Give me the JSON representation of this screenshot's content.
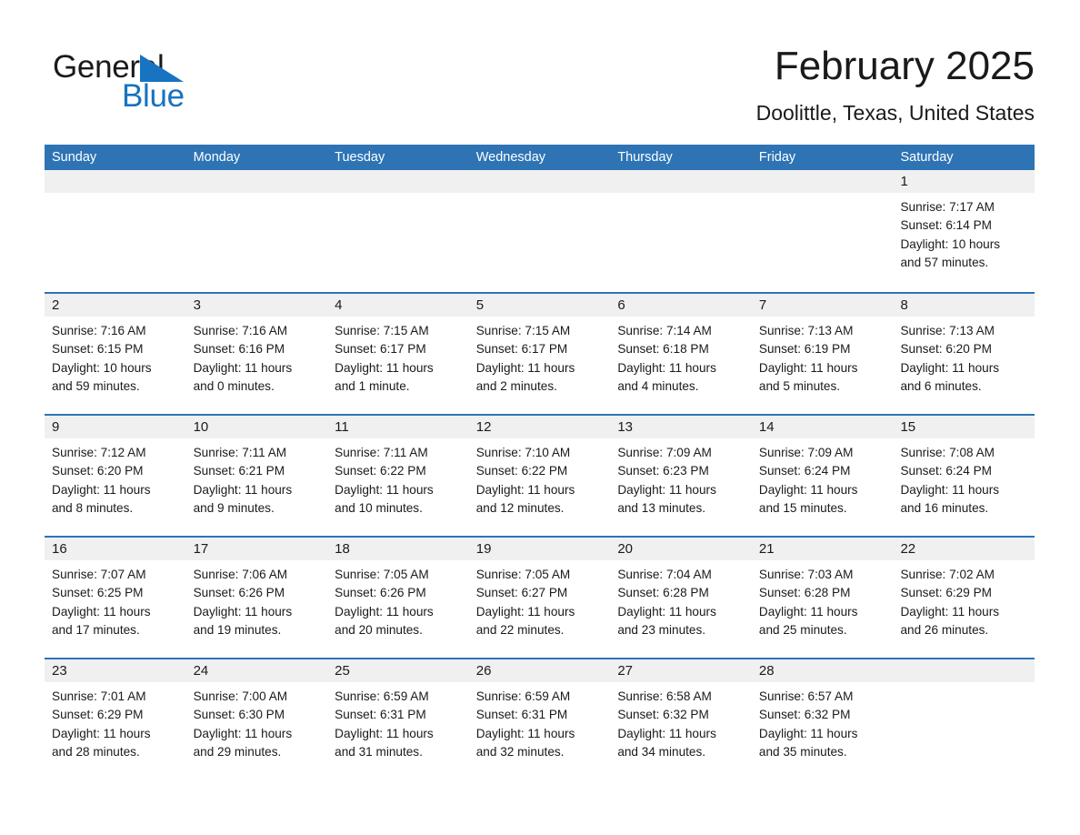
{
  "brand": {
    "name_part1": "General",
    "name_part2": "Blue",
    "triangle_color": "#1873c0",
    "text_color": "#1a1a1a"
  },
  "header": {
    "month_title": "February 2025",
    "location": "Doolittle, Texas, United States"
  },
  "colors": {
    "header_blue": "#2e74b5",
    "daynum_band": "#f0f0f0",
    "page_background": "#ffffff",
    "text": "#1a1a1a"
  },
  "weekday_headers": [
    "Sunday",
    "Monday",
    "Tuesday",
    "Wednesday",
    "Thursday",
    "Friday",
    "Saturday"
  ],
  "weeks": [
    [
      {
        "day": "",
        "lines": []
      },
      {
        "day": "",
        "lines": []
      },
      {
        "day": "",
        "lines": []
      },
      {
        "day": "",
        "lines": []
      },
      {
        "day": "",
        "lines": []
      },
      {
        "day": "",
        "lines": []
      },
      {
        "day": "1",
        "lines": [
          "Sunrise: 7:17 AM",
          "Sunset: 6:14 PM",
          "Daylight: 10 hours",
          "and 57 minutes."
        ]
      }
    ],
    [
      {
        "day": "2",
        "lines": [
          "Sunrise: 7:16 AM",
          "Sunset: 6:15 PM",
          "Daylight: 10 hours",
          "and 59 minutes."
        ]
      },
      {
        "day": "3",
        "lines": [
          "Sunrise: 7:16 AM",
          "Sunset: 6:16 PM",
          "Daylight: 11 hours",
          "and 0 minutes."
        ]
      },
      {
        "day": "4",
        "lines": [
          "Sunrise: 7:15 AM",
          "Sunset: 6:17 PM",
          "Daylight: 11 hours",
          "and 1 minute."
        ]
      },
      {
        "day": "5",
        "lines": [
          "Sunrise: 7:15 AM",
          "Sunset: 6:17 PM",
          "Daylight: 11 hours",
          "and 2 minutes."
        ]
      },
      {
        "day": "6",
        "lines": [
          "Sunrise: 7:14 AM",
          "Sunset: 6:18 PM",
          "Daylight: 11 hours",
          "and 4 minutes."
        ]
      },
      {
        "day": "7",
        "lines": [
          "Sunrise: 7:13 AM",
          "Sunset: 6:19 PM",
          "Daylight: 11 hours",
          "and 5 minutes."
        ]
      },
      {
        "day": "8",
        "lines": [
          "Sunrise: 7:13 AM",
          "Sunset: 6:20 PM",
          "Daylight: 11 hours",
          "and 6 minutes."
        ]
      }
    ],
    [
      {
        "day": "9",
        "lines": [
          "Sunrise: 7:12 AM",
          "Sunset: 6:20 PM",
          "Daylight: 11 hours",
          "and 8 minutes."
        ]
      },
      {
        "day": "10",
        "lines": [
          "Sunrise: 7:11 AM",
          "Sunset: 6:21 PM",
          "Daylight: 11 hours",
          "and 9 minutes."
        ]
      },
      {
        "day": "11",
        "lines": [
          "Sunrise: 7:11 AM",
          "Sunset: 6:22 PM",
          "Daylight: 11 hours",
          "and 10 minutes."
        ]
      },
      {
        "day": "12",
        "lines": [
          "Sunrise: 7:10 AM",
          "Sunset: 6:22 PM",
          "Daylight: 11 hours",
          "and 12 minutes."
        ]
      },
      {
        "day": "13",
        "lines": [
          "Sunrise: 7:09 AM",
          "Sunset: 6:23 PM",
          "Daylight: 11 hours",
          "and 13 minutes."
        ]
      },
      {
        "day": "14",
        "lines": [
          "Sunrise: 7:09 AM",
          "Sunset: 6:24 PM",
          "Daylight: 11 hours",
          "and 15 minutes."
        ]
      },
      {
        "day": "15",
        "lines": [
          "Sunrise: 7:08 AM",
          "Sunset: 6:24 PM",
          "Daylight: 11 hours",
          "and 16 minutes."
        ]
      }
    ],
    [
      {
        "day": "16",
        "lines": [
          "Sunrise: 7:07 AM",
          "Sunset: 6:25 PM",
          "Daylight: 11 hours",
          "and 17 minutes."
        ]
      },
      {
        "day": "17",
        "lines": [
          "Sunrise: 7:06 AM",
          "Sunset: 6:26 PM",
          "Daylight: 11 hours",
          "and 19 minutes."
        ]
      },
      {
        "day": "18",
        "lines": [
          "Sunrise: 7:05 AM",
          "Sunset: 6:26 PM",
          "Daylight: 11 hours",
          "and 20 minutes."
        ]
      },
      {
        "day": "19",
        "lines": [
          "Sunrise: 7:05 AM",
          "Sunset: 6:27 PM",
          "Daylight: 11 hours",
          "and 22 minutes."
        ]
      },
      {
        "day": "20",
        "lines": [
          "Sunrise: 7:04 AM",
          "Sunset: 6:28 PM",
          "Daylight: 11 hours",
          "and 23 minutes."
        ]
      },
      {
        "day": "21",
        "lines": [
          "Sunrise: 7:03 AM",
          "Sunset: 6:28 PM",
          "Daylight: 11 hours",
          "and 25 minutes."
        ]
      },
      {
        "day": "22",
        "lines": [
          "Sunrise: 7:02 AM",
          "Sunset: 6:29 PM",
          "Daylight: 11 hours",
          "and 26 minutes."
        ]
      }
    ],
    [
      {
        "day": "23",
        "lines": [
          "Sunrise: 7:01 AM",
          "Sunset: 6:29 PM",
          "Daylight: 11 hours",
          "and 28 minutes."
        ]
      },
      {
        "day": "24",
        "lines": [
          "Sunrise: 7:00 AM",
          "Sunset: 6:30 PM",
          "Daylight: 11 hours",
          "and 29 minutes."
        ]
      },
      {
        "day": "25",
        "lines": [
          "Sunrise: 6:59 AM",
          "Sunset: 6:31 PM",
          "Daylight: 11 hours",
          "and 31 minutes."
        ]
      },
      {
        "day": "26",
        "lines": [
          "Sunrise: 6:59 AM",
          "Sunset: 6:31 PM",
          "Daylight: 11 hours",
          "and 32 minutes."
        ]
      },
      {
        "day": "27",
        "lines": [
          "Sunrise: 6:58 AM",
          "Sunset: 6:32 PM",
          "Daylight: 11 hours",
          "and 34 minutes."
        ]
      },
      {
        "day": "28",
        "lines": [
          "Sunrise: 6:57 AM",
          "Sunset: 6:32 PM",
          "Daylight: 11 hours",
          "and 35 minutes."
        ]
      },
      {
        "day": "",
        "lines": []
      }
    ]
  ]
}
